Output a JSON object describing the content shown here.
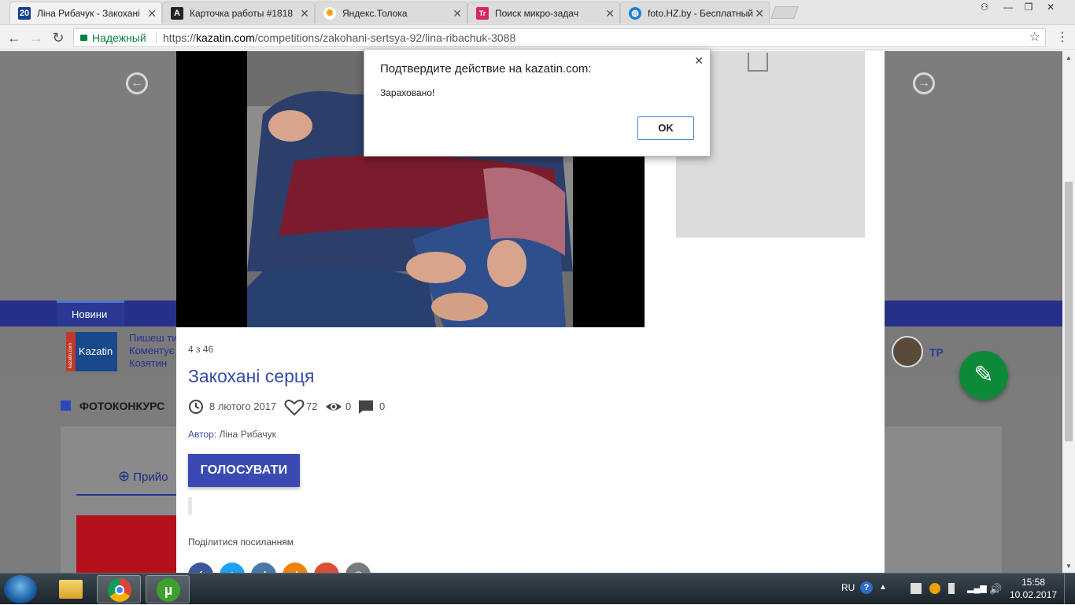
{
  "browser": {
    "tabs": [
      {
        "title": "Ліна Рибачук - Закохані",
        "favicon": "20",
        "active": true
      },
      {
        "title": "Карточка работы #1818",
        "favicon": "A",
        "active": false
      },
      {
        "title": "Яндекс.Толока",
        "favicon": "sun",
        "active": false
      },
      {
        "title": "Поиск микро-задач",
        "favicon": "Tr",
        "active": false
      },
      {
        "title": "foto.HZ.by - Бесплатный",
        "favicon": "globe",
        "active": false
      }
    ],
    "secure_label": "Надежный",
    "url_scheme": "https://",
    "url_host": "kazatin.com",
    "url_path": "/competitions/zakohani-sertsya-92/lina-ribachuk-3088"
  },
  "site": {
    "nav_news": "Новини",
    "logo_text": "Kazatin",
    "logo_side_text": "kazatin.com",
    "strip_lines": [
      "Пишеш ти",
      "Коментує",
      "Козятин"
    ],
    "section_title": "ФОТОКОНКУРС",
    "add_button": "Прийо",
    "avatar_label": "ТР"
  },
  "lightbox": {
    "counter": "4 з 46",
    "title": "Закохані серця",
    "date": "8 лютого 2017",
    "likes": "72",
    "views": "0",
    "comments": "0",
    "author_label": "Автор:",
    "author_name": "Ліна Рибачук",
    "vote_button": "ГОЛОСУВАТИ",
    "share_label": "Поділитися посиланням",
    "share_buttons": [
      {
        "name": "facebook",
        "color": "#3b5998",
        "glyph": "f"
      },
      {
        "name": "twitter",
        "color": "#1da1f2",
        "glyph": "t"
      },
      {
        "name": "vk",
        "color": "#4a76a8",
        "glyph": "vk"
      },
      {
        "name": "odnoklassniki",
        "color": "#ee8208",
        "glyph": "ok"
      },
      {
        "name": "google-plus",
        "color": "#dd4b39",
        "glyph": "g+"
      },
      {
        "name": "email",
        "color": "#7a7a7a",
        "glyph": "@"
      }
    ]
  },
  "dialog": {
    "title": "Подтвердите действие на kazatin.com:",
    "message": "Зараховано!",
    "ok_label": "OK"
  },
  "taskbar": {
    "language": "RU",
    "time": "15:58",
    "date": "10.02.2017",
    "apps": [
      "explorer",
      "chrome",
      "utorrent"
    ]
  },
  "colors": {
    "accent": "#3b4ab2",
    "title": "#3949ab",
    "navbar": "#263089",
    "fab": "#0c8a3a"
  }
}
